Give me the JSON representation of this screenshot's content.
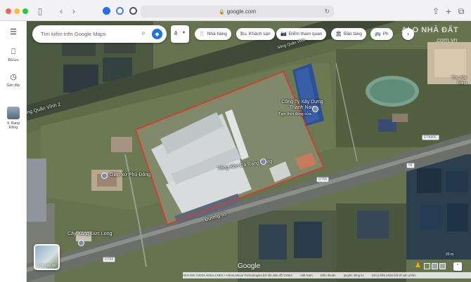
{
  "browser": {
    "address": "google.com",
    "lock_icon": "lock-icon",
    "reload_icon": "reload-icon"
  },
  "sidebar": {
    "menu_icon": "menu-icon",
    "items": [
      {
        "label": "Đã lưu",
        "icon": "bookmark-icon"
      },
      {
        "label": "Gần đây",
        "icon": "history-icon"
      },
      {
        "label": "tt. Rạng Đông",
        "icon": "place-thumbnail"
      }
    ]
  },
  "search": {
    "placeholder": "Tìm kiếm trên Google Maps",
    "search_icon": "search-icon",
    "directions_icon": "directions-icon"
  },
  "mini_control": {
    "text": "ê",
    "arrow": "▾"
  },
  "chips": [
    {
      "label": "Nhà hàng",
      "icon": "🍴"
    },
    {
      "label": "Khách sạn",
      "icon": "🛏"
    },
    {
      "label": "Điểm tham quan",
      "icon": "📷"
    },
    {
      "label": "Bảo tàng",
      "icon": "🏛"
    },
    {
      "label": "Ph",
      "icon": "🚌"
    }
  ],
  "watermark": {
    "main": "ALO NHÀ ĐẤT",
    "sub": ".com.vn"
  },
  "map_labels": {
    "company": "Công Ty Xây Dựng Thanh Nam",
    "company_sub": "Tạm thời đóng cửa",
    "warehouse": "Tổng Kho Đá Rạng Đông",
    "parish": "Giáo xứ Phú Đông",
    "gas_station": "Cây Xăng Đức Long",
    "street": "Đường 55",
    "canal": "ông Quần Vĩnh 2",
    "canal_top": "Sông Quần Vĩnh",
    "right_cut": "Trúc Xây",
    "right_cut2": "Trắng"
  },
  "road_shields": [
    "DT490C",
    "55",
    "DT55",
    "DT55"
  ],
  "layers": {
    "label": "Lớp bản đồ"
  },
  "google_logo": "Google",
  "bottom_bar": {
    "attribution": "Hình ảnh ©2024 Airbus,CNES / Airbus,Maxar Technologies,Dữ liệu bản đồ ©2024",
    "links": [
      "Việt Nam",
      "Điều khoản",
      "Quyền riêng tư",
      "Gửi ý kiến phản hồi về sản phẩm"
    ],
    "scale": "20 m"
  },
  "colors": {
    "accent": "#1a73e8",
    "outline": "#e8302a"
  }
}
